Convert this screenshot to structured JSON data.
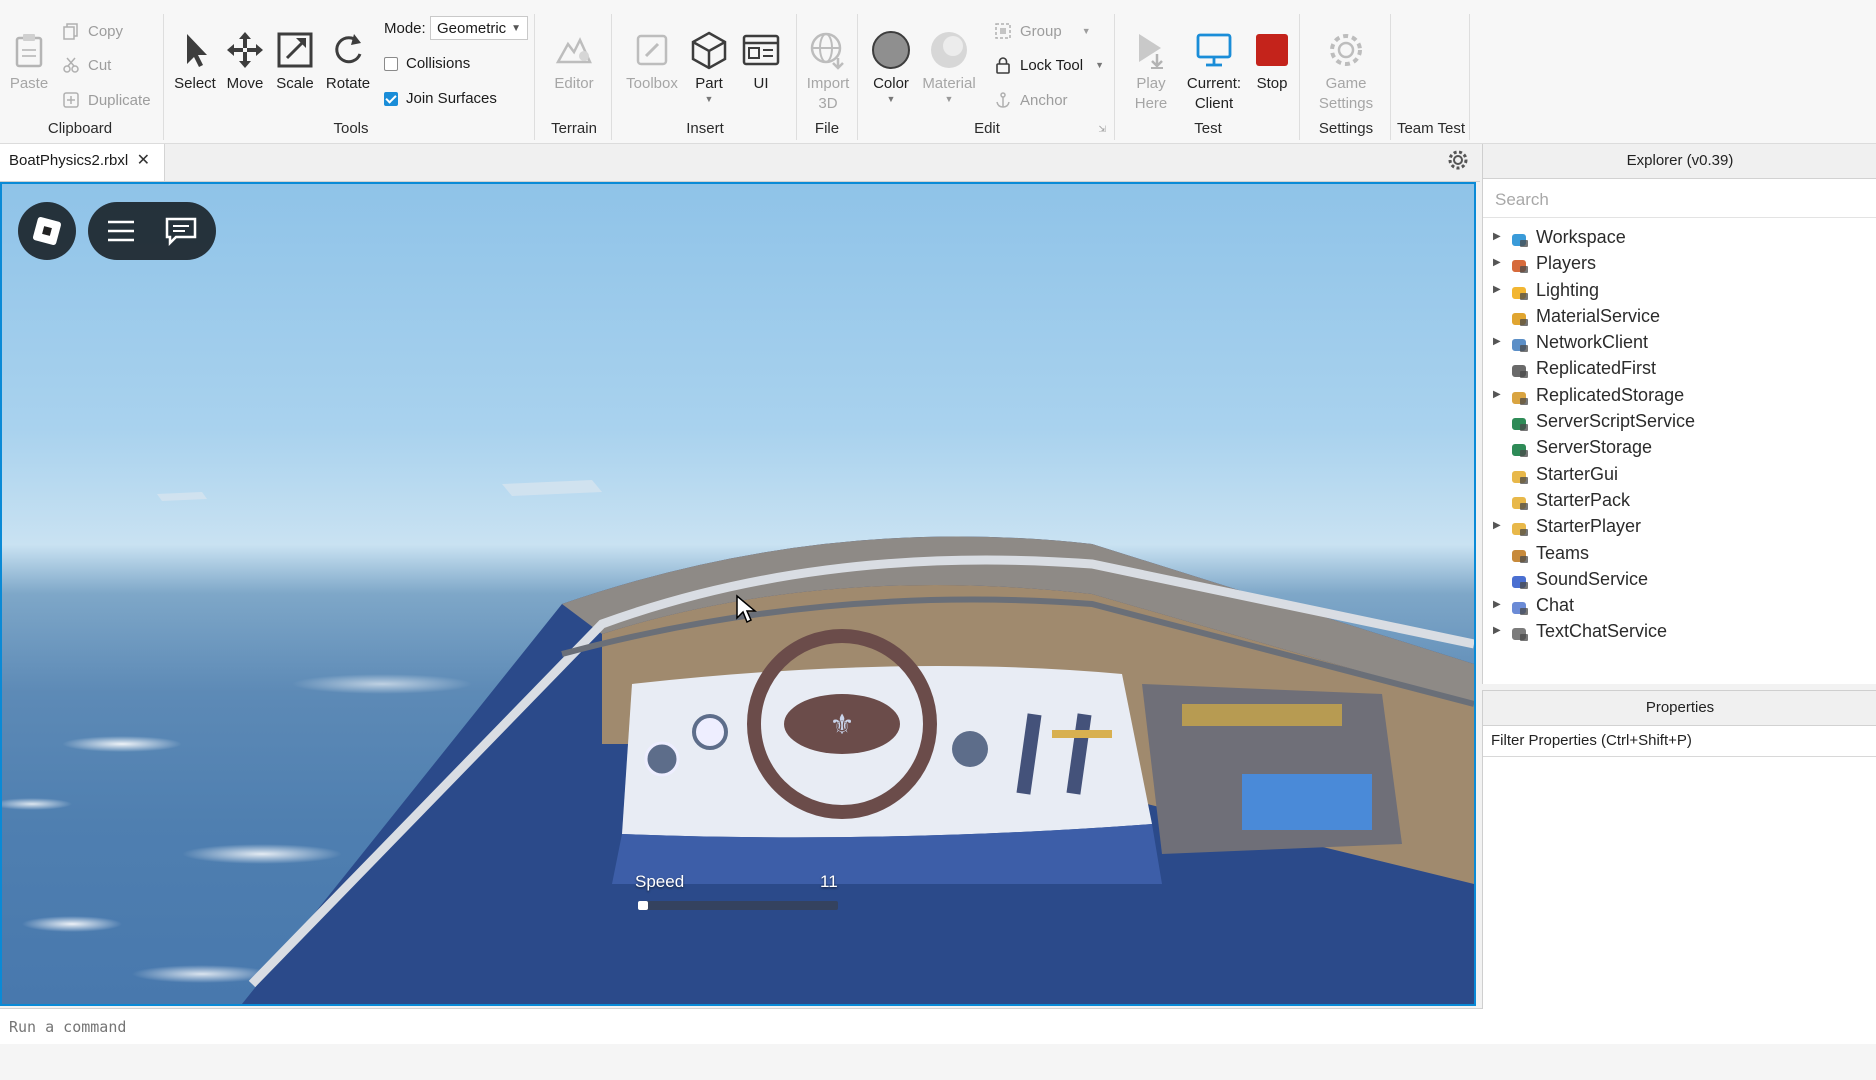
{
  "ribbon": {
    "clipboard": {
      "paste": "Paste",
      "copy": "Copy",
      "cut": "Cut",
      "duplicate": "Duplicate",
      "label": "Clipboard"
    },
    "tools": {
      "select": "Select",
      "move": "Move",
      "scale": "Scale",
      "rotate": "Rotate",
      "mode_label": "Mode:",
      "mode_value": "Geometric",
      "collisions": "Collisions",
      "join_surfaces": "Join Surfaces",
      "label": "Tools"
    },
    "terrain": {
      "editor": "Editor",
      "label": "Terrain"
    },
    "insert": {
      "toolbox": "Toolbox",
      "part": "Part",
      "ui": "UI",
      "label": "Insert"
    },
    "file": {
      "import3d_line1": "Import",
      "import3d_line2": "3D",
      "label": "File"
    },
    "edit": {
      "color": "Color",
      "material": "Material",
      "group": "Group",
      "lock_tool": "Lock Tool",
      "anchor": "Anchor",
      "label": "Edit"
    },
    "test": {
      "play_here_line1": "Play",
      "play_here_line2": "Here",
      "current_client_line1": "Current:",
      "current_client_line2": "Client",
      "stop": "Stop",
      "label": "Test"
    },
    "settings": {
      "game_settings_line1": "Game",
      "game_settings_line2": "Settings",
      "label": "Settings"
    },
    "team_test": {
      "label": "Team Test"
    }
  },
  "tabs": [
    {
      "label": "BoatPhysics2.rbxl"
    }
  ],
  "viewport": {
    "speed_label": "Speed",
    "speed_value": "11",
    "speed_fraction": 0.05
  },
  "command_bar": {
    "placeholder": "Run a command"
  },
  "explorer": {
    "title": "Explorer (v0.39)",
    "search_placeholder": "Search",
    "items": [
      {
        "label": "Workspace",
        "expandable": true,
        "icon": "workspace-icon",
        "color": "#3a9bd9"
      },
      {
        "label": "Players",
        "expandable": true,
        "icon": "players-icon",
        "color": "#d66a3b"
      },
      {
        "label": "Lighting",
        "expandable": true,
        "icon": "lighting-icon",
        "color": "#f2b632"
      },
      {
        "label": "MaterialService",
        "expandable": false,
        "icon": "material-service-icon",
        "color": "#e0a530"
      },
      {
        "label": "NetworkClient",
        "expandable": true,
        "icon": "network-client-icon",
        "color": "#5c8fc7"
      },
      {
        "label": "ReplicatedFirst",
        "expandable": false,
        "icon": "replicated-first-icon",
        "color": "#6a6a6a"
      },
      {
        "label": "ReplicatedStorage",
        "expandable": true,
        "icon": "replicated-storage-icon",
        "color": "#d9a441"
      },
      {
        "label": "ServerScriptService",
        "expandable": false,
        "icon": "server-script-service-icon",
        "color": "#2e8b57"
      },
      {
        "label": "ServerStorage",
        "expandable": false,
        "icon": "server-storage-icon",
        "color": "#2e8b57"
      },
      {
        "label": "StarterGui",
        "expandable": false,
        "icon": "starter-gui-icon",
        "color": "#e8b84a"
      },
      {
        "label": "StarterPack",
        "expandable": false,
        "icon": "starter-pack-icon",
        "color": "#e8b84a"
      },
      {
        "label": "StarterPlayer",
        "expandable": true,
        "icon": "starter-player-icon",
        "color": "#e8b84a"
      },
      {
        "label": "Teams",
        "expandable": false,
        "icon": "teams-icon",
        "color": "#c78a3b"
      },
      {
        "label": "SoundService",
        "expandable": false,
        "icon": "sound-service-icon",
        "color": "#4a6fd1"
      },
      {
        "label": "Chat",
        "expandable": true,
        "icon": "chat-icon",
        "color": "#6b8bd6"
      },
      {
        "label": "TextChatService",
        "expandable": true,
        "icon": "text-chat-service-icon",
        "color": "#7b7b7b"
      }
    ]
  },
  "properties": {
    "title": "Properties",
    "filter_placeholder": "Filter Properties (Ctrl+Shift+P)"
  },
  "colors": {
    "accent": "#0a8ad6",
    "stop": "#c4231b",
    "checkbox": "#1a8dd8"
  }
}
